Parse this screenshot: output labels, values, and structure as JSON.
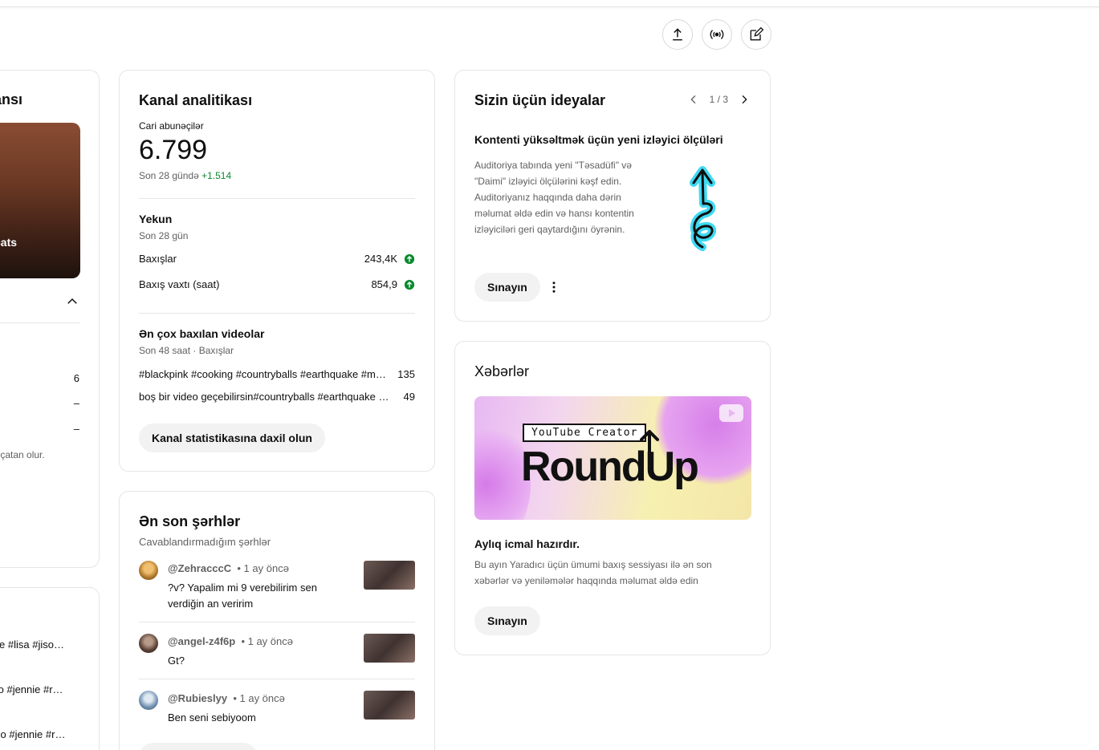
{
  "header": {
    "icons": [
      "upload-icon",
      "live-icon",
      "edit-icon"
    ]
  },
  "left": {
    "title_fragment": "hansı",
    "thumb_text": "cats",
    "values": [
      "6",
      "–",
      "–"
    ],
    "note": "a alçatan olur.",
    "list": [
      "rose #lisa #jiso…",
      "isoo #jennie #r…",
      "jisoo #jennie #r…"
    ]
  },
  "analytics": {
    "title": "Kanal analitikası",
    "subs_label": "Cari abunəçilər",
    "subs_value": "6.799",
    "subs_period": "Son 28 gündə",
    "subs_delta": "+1.514",
    "summary_title": "Yekun",
    "summary_period": "Son 28 gün",
    "metrics": [
      {
        "label": "Baxışlar",
        "value": "243,4K"
      },
      {
        "label": "Baxış vaxtı (saat)",
        "value": "854,9"
      }
    ],
    "top_title": "Ən çox baxılan videolar",
    "top_period": "Son 48 saat · Baxışlar",
    "top_videos": [
      {
        "title": "#blackpink #cooking #countryballs #earthquake #mu…",
        "views": "135"
      },
      {
        "title": "boş bir video geçebilirsin#countryballs #earthquake …",
        "views": "49"
      }
    ],
    "button": "Kanal statistikasına daxil olun"
  },
  "comments": {
    "title": "Ən son şərhlər",
    "subtitle": "Cavablandırmadığım şərhlər",
    "items": [
      {
        "author": "@ZehracccC",
        "time": "• 1 ay öncə",
        "text": "?v? Yapalim mi 9 verebilirim sen verdiğin an veririm",
        "avatar_color": "#b07a2a"
      },
      {
        "author": "@angel-z4f6p",
        "time": "• 1 ay öncə",
        "text": "Gt?",
        "avatar_color": "#5a4036"
      },
      {
        "author": "@Rubieslyy",
        "time": "• 1 ay öncə",
        "text": "Ben seni sebiyoom",
        "avatar_color": "#6f8fb0"
      }
    ]
  },
  "ideas": {
    "title": "Sizin üçün ideyalar",
    "pager": "1 / 3",
    "headline": "Kontenti yüksəltmək üçün yeni izləyici ölçüləri",
    "body": "Auditoriya tabında yeni \"Təsadüfi\" və \"Daimi\" izləyici ölçülərini kəşf edin. Auditoriyanız haqqında daha dərin məlumat əldə edin və hansı kontentin izləyiciləri geri qaytardığını öyrənin.",
    "button": "Sınayın"
  },
  "news": {
    "title": "Xəbərlər",
    "banner_tag": "YouTube Creator",
    "banner_title": "RoundUp",
    "headline": "Aylıq icmal hazırdır.",
    "body": "Bu ayın Yaradıcı üçün ümumi baxış sessiyası ilə ən son xəbərlər və yeniləmələr haqqında məlumat əldə edin",
    "button": "Sınayın"
  },
  "colors": {
    "positive": "#0a8a2e",
    "accent_cyan": "#3fd9f2"
  }
}
